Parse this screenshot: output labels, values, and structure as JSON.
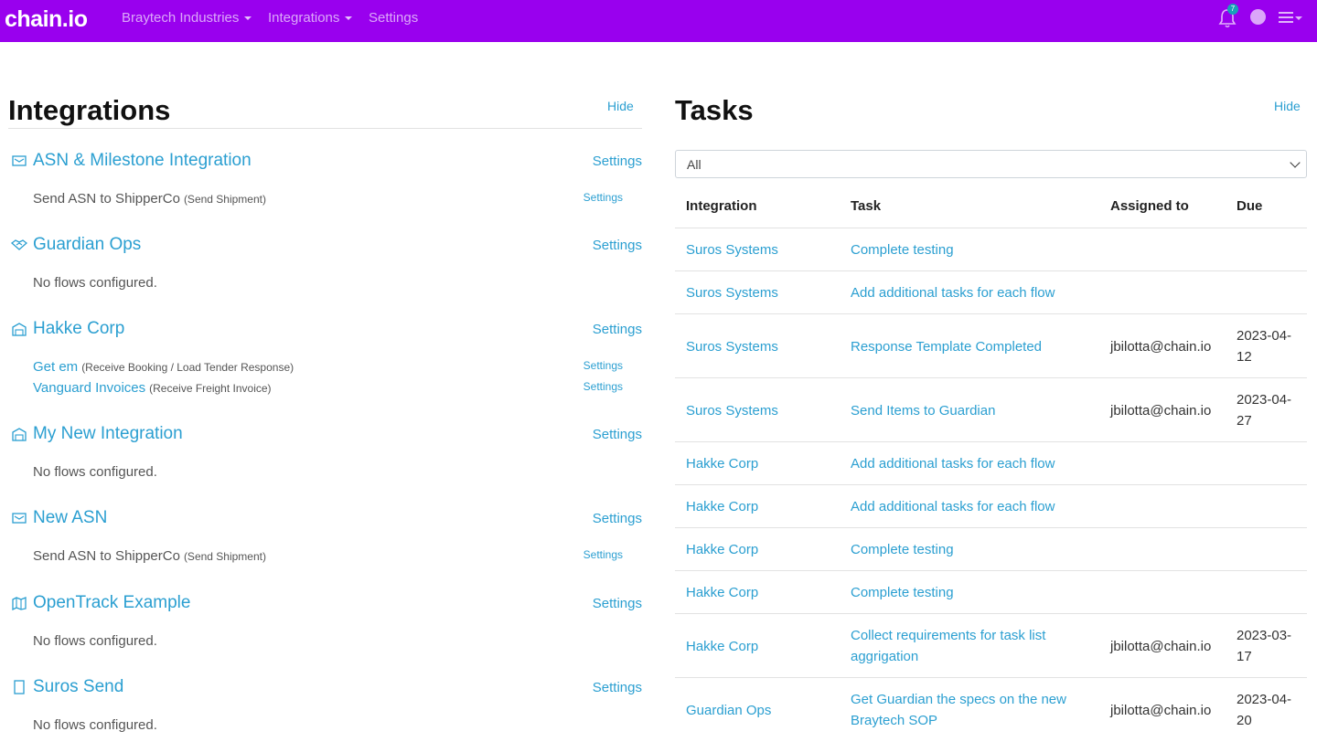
{
  "nav": {
    "brand_main": "chain",
    "brand_dot": ".",
    "brand_suffix": "io",
    "org": "Braytech Industries",
    "integrations": "Integrations",
    "settings": "Settings",
    "notification_count": "7"
  },
  "left": {
    "title": "Integrations",
    "hide": "Hide",
    "integrations": [
      {
        "name": "ASN & Milestone Integration",
        "icon": "envelope-icon",
        "settings": "Settings",
        "flows": [
          {
            "name": "Send ASN to ShipperCo",
            "link": false,
            "sub": "(Send Shipment)",
            "settings": "Settings"
          }
        ]
      },
      {
        "name": "Guardian Ops",
        "icon": "handshake-icon",
        "settings": "Settings",
        "no_flows": "No flows configured."
      },
      {
        "name": "Hakke Corp",
        "icon": "warehouse-icon",
        "settings": "Settings",
        "flows": [
          {
            "name": "Get em",
            "link": true,
            "sub": "(Receive Booking / Load Tender Response)",
            "settings": "Settings"
          },
          {
            "name": "Vanguard Invoices",
            "link": true,
            "sub": "(Receive Freight Invoice)",
            "settings": "Settings"
          }
        ]
      },
      {
        "name": "My New Integration",
        "icon": "warehouse-icon",
        "settings": "Settings",
        "no_flows": "No flows configured."
      },
      {
        "name": "New ASN",
        "icon": "envelope-icon",
        "settings": "Settings",
        "flows": [
          {
            "name": "Send ASN to ShipperCo",
            "link": false,
            "sub": "(Send Shipment)",
            "settings": "Settings"
          }
        ]
      },
      {
        "name": "OpenTrack Example",
        "icon": "map-icon",
        "settings": "Settings",
        "no_flows": "No flows configured."
      },
      {
        "name": "Suros Send",
        "icon": "document-icon",
        "settings": "Settings",
        "no_flows": "No flows configured."
      }
    ]
  },
  "right": {
    "title": "Tasks",
    "hide": "Hide",
    "filter_value": "All",
    "columns": [
      "Integration",
      "Task",
      "Assigned to",
      "Due"
    ],
    "rows": [
      {
        "integration": "Suros Systems",
        "task": [
          "Complete testing"
        ],
        "assigned": "",
        "due": []
      },
      {
        "integration": "Suros Systems",
        "task": [
          "Add additional tasks for each flow"
        ],
        "assigned": "",
        "due": []
      },
      {
        "integration": "Suros Systems",
        "task": [
          "Response Template Completed"
        ],
        "assigned": "jbilotta@chain.io",
        "due": [
          "2023-04-",
          "12"
        ]
      },
      {
        "integration": "Suros Systems",
        "task": [
          "Send Items to Guardian"
        ],
        "assigned": "jbilotta@chain.io",
        "due": [
          "2023-04-",
          "27"
        ]
      },
      {
        "integration": "Hakke Corp",
        "task": [
          "Add additional tasks for each flow"
        ],
        "assigned": "",
        "due": []
      },
      {
        "integration": "Hakke Corp",
        "task": [
          "Add additional tasks for each flow"
        ],
        "assigned": "",
        "due": []
      },
      {
        "integration": "Hakke Corp",
        "task": [
          "Complete testing"
        ],
        "assigned": "",
        "due": []
      },
      {
        "integration": "Hakke Corp",
        "task": [
          "Complete testing"
        ],
        "assigned": "",
        "due": []
      },
      {
        "integration": "Hakke Corp",
        "task": [
          "Collect requirements for task list",
          "aggrigation"
        ],
        "assigned": "jbilotta@chain.io",
        "due": [
          "2023-03-",
          "17"
        ]
      },
      {
        "integration": "Guardian Ops",
        "task": [
          "Get Guardian the specs on the new",
          "Braytech SOP"
        ],
        "assigned": "jbilotta@chain.io",
        "due": [
          "2023-04-",
          "20"
        ]
      }
    ]
  }
}
